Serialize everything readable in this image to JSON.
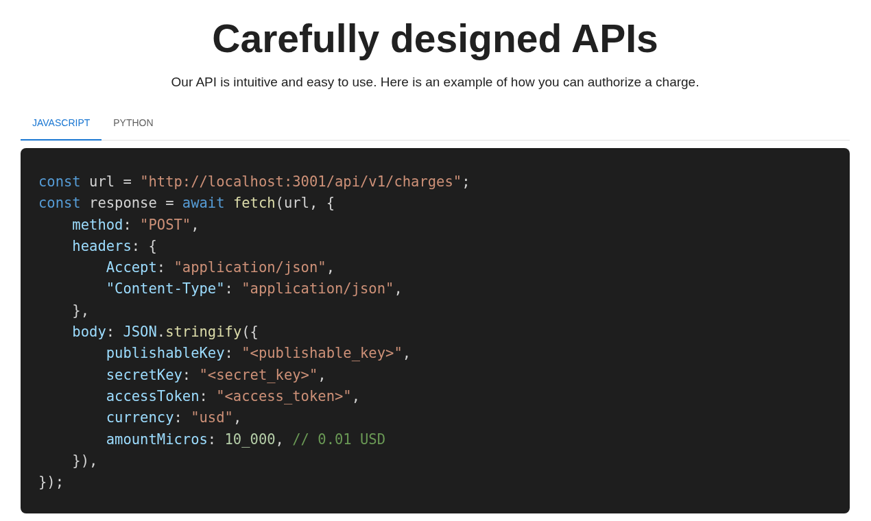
{
  "heading": "Carefully designed APIs",
  "subtitle": "Our API is intuitive and easy to use. Here is an example of how you can authorize a charge.",
  "tabs": [
    {
      "label": "JAVASCRIPT",
      "selected": true
    },
    {
      "label": "PYTHON",
      "selected": false
    }
  ],
  "code_lines": [
    {
      "tokens": [
        {
          "kind": "keyword",
          "text": "const"
        },
        {
          "kind": "plain",
          "text": " url = "
        },
        {
          "kind": "string",
          "text": "\"http://localhost:3001/api/v1/charges\""
        },
        {
          "kind": "plain",
          "text": ";"
        }
      ]
    },
    {
      "tokens": [
        {
          "kind": "keyword",
          "text": "const"
        },
        {
          "kind": "plain",
          "text": " response = "
        },
        {
          "kind": "keyword",
          "text": "await"
        },
        {
          "kind": "function",
          "text": " fetch"
        },
        {
          "kind": "plain",
          "text": "(url, {"
        }
      ],
      "children": [
        {
          "tokens": [
            {
              "kind": "property",
              "text": "method"
            },
            {
              "kind": "plain",
              "text": ": "
            },
            {
              "kind": "string",
              "text": "\"POST\""
            },
            {
              "kind": "plain",
              "text": ","
            }
          ]
        },
        {
          "tokens": [
            {
              "kind": "property",
              "text": "headers"
            },
            {
              "kind": "plain",
              "text": ": {"
            }
          ],
          "children": [
            {
              "tokens": [
                {
                  "kind": "property",
                  "text": "Accept"
                },
                {
                  "kind": "plain",
                  "text": ": "
                },
                {
                  "kind": "string",
                  "text": "\"application/json\""
                },
                {
                  "kind": "plain",
                  "text": ","
                }
              ]
            },
            {
              "tokens": [
                {
                  "kind": "property",
                  "text": "\"Content-Type\""
                },
                {
                  "kind": "plain",
                  "text": ": "
                },
                {
                  "kind": "string",
                  "text": "\"application/json\""
                },
                {
                  "kind": "plain",
                  "text": ","
                }
              ]
            }
          ]
        },
        {
          "tokens": [
            {
              "kind": "plain",
              "text": "},"
            }
          ]
        },
        {
          "tokens": [
            {
              "kind": "property",
              "text": "body"
            },
            {
              "kind": "plain",
              "text": ": "
            },
            {
              "kind": "property",
              "text": "JSON"
            },
            {
              "kind": "plain",
              "text": "."
            },
            {
              "kind": "function",
              "text": "stringify"
            },
            {
              "kind": "plain",
              "text": "({"
            }
          ],
          "children": [
            {
              "tokens": [
                {
                  "kind": "property",
                  "text": "publishableKey"
                },
                {
                  "kind": "plain",
                  "text": ": "
                },
                {
                  "kind": "string",
                  "text": "\"<publishable_key>\""
                },
                {
                  "kind": "plain",
                  "text": ","
                }
              ]
            },
            {
              "tokens": [
                {
                  "kind": "property",
                  "text": "secretKey"
                },
                {
                  "kind": "plain",
                  "text": ": "
                },
                {
                  "kind": "string",
                  "text": "\"<secret_key>\""
                },
                {
                  "kind": "plain",
                  "text": ","
                }
              ]
            },
            {
              "tokens": [
                {
                  "kind": "property",
                  "text": "accessToken"
                },
                {
                  "kind": "plain",
                  "text": ": "
                },
                {
                  "kind": "string",
                  "text": "\"<access_token>\""
                },
                {
                  "kind": "plain",
                  "text": ","
                }
              ]
            },
            {
              "tokens": [
                {
                  "kind": "property",
                  "text": "currency"
                },
                {
                  "kind": "plain",
                  "text": ": "
                },
                {
                  "kind": "string",
                  "text": "\"usd\""
                },
                {
                  "kind": "plain",
                  "text": ","
                }
              ]
            },
            {
              "tokens": [
                {
                  "kind": "property",
                  "text": "amountMicros"
                },
                {
                  "kind": "plain",
                  "text": ": "
                },
                {
                  "kind": "number",
                  "text": "10_000"
                },
                {
                  "kind": "plain",
                  "text": ", "
                },
                {
                  "kind": "comment",
                  "text": "// 0.01 USD"
                }
              ]
            }
          ]
        },
        {
          "tokens": [
            {
              "kind": "plain",
              "text": "}),"
            }
          ]
        }
      ]
    },
    {
      "tokens": [
        {
          "kind": "plain",
          "text": "});"
        }
      ]
    }
  ]
}
